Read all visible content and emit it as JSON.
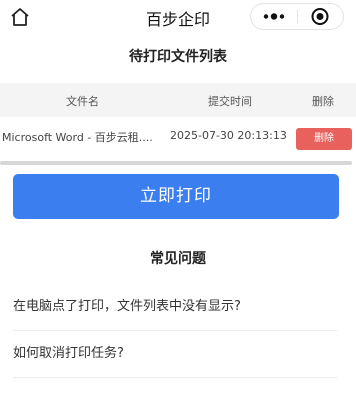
{
  "app": {
    "title": "百步企印"
  },
  "icons": {
    "home": "home-icon",
    "more": "more-dots-icon",
    "close": "close-target-icon"
  },
  "file_list": {
    "title": "待打印文件列表",
    "columns": [
      "文件名",
      "提交时间",
      "删除"
    ],
    "rows": [
      {
        "name": "Microsoft Word - 百步云租....",
        "time": "2025-07-30 20:13:13",
        "action": "删除"
      }
    ]
  },
  "print": {
    "label": "立即打印",
    "color": "#3b7ef0"
  },
  "delete_color": "#e8615c",
  "faq": {
    "title": "常见问题",
    "items": [
      "在电脑点了打印，文件列表中没有显示?",
      "如何取消打印任务?"
    ]
  }
}
